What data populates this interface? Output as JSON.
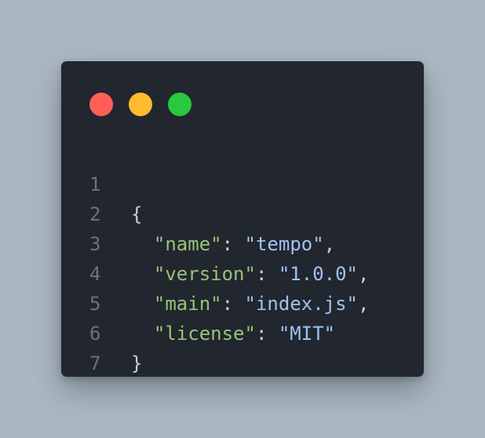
{
  "window_controls": {
    "close_color": "#ff5f57",
    "minimize_color": "#febc2e",
    "maximize_color": "#28c840"
  },
  "code": {
    "line_numbers": [
      "1",
      "2",
      "3",
      "4",
      "5",
      "6",
      "7"
    ],
    "open_brace": "{",
    "close_brace": "}",
    "entries": [
      {
        "key": "\"name\"",
        "value": "\"tempo\"",
        "comma": ","
      },
      {
        "key": "\"version\"",
        "value": "\"1.0.0\"",
        "comma": ","
      },
      {
        "key": "\"main\"",
        "value": "\"index.js\"",
        "comma": ","
      },
      {
        "key": "\"license\"",
        "value": "\"MIT\"",
        "comma": ""
      }
    ],
    "colon": ": ",
    "indent": "  "
  },
  "colors": {
    "background": "#abb8c3",
    "window": "#22262e",
    "key": "#98c379",
    "string": "#9ec3f0",
    "punctuation": "#c9cdd4",
    "line_number": "#6b7280"
  }
}
